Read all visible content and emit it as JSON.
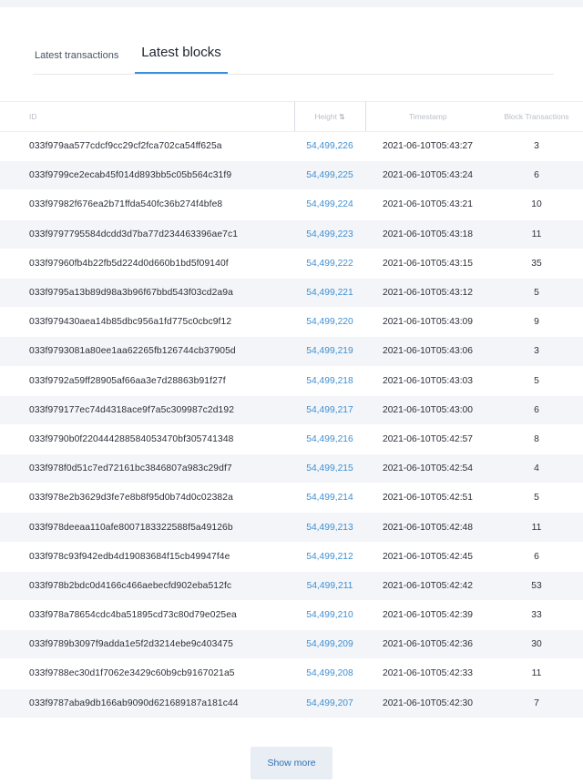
{
  "tabs": [
    {
      "label": "Latest transactions",
      "active": false
    },
    {
      "label": "Latest blocks",
      "active": true
    }
  ],
  "table": {
    "headers": {
      "id": "ID",
      "height": "Height",
      "timestamp": "Timestamp",
      "block_transactions": "Block Transactions"
    },
    "sort_icon": "sort-icon",
    "rows": [
      {
        "id": "033f979aa577cdcf9cc29cf2fca702ca54ff625a",
        "height": "54,499,226",
        "timestamp": "2021-06-10T05:43:27",
        "tx": "3"
      },
      {
        "id": "033f9799ce2ecab45f014d893bb5c05b564c31f9",
        "height": "54,499,225",
        "timestamp": "2021-06-10T05:43:24",
        "tx": "6"
      },
      {
        "id": "033f97982f676ea2b71ffda540fc36b274f4bfe8",
        "height": "54,499,224",
        "timestamp": "2021-06-10T05:43:21",
        "tx": "10"
      },
      {
        "id": "033f9797795584dcdd3d7ba77d234463396ae7c1",
        "height": "54,499,223",
        "timestamp": "2021-06-10T05:43:18",
        "tx": "11"
      },
      {
        "id": "033f97960fb4b22fb5d224d0d660b1bd5f09140f",
        "height": "54,499,222",
        "timestamp": "2021-06-10T05:43:15",
        "tx": "35"
      },
      {
        "id": "033f9795a13b89d98a3b96f67bbd543f03cd2a9a",
        "height": "54,499,221",
        "timestamp": "2021-06-10T05:43:12",
        "tx": "5"
      },
      {
        "id": "033f979430aea14b85dbc956a1fd775c0cbc9f12",
        "height": "54,499,220",
        "timestamp": "2021-06-10T05:43:09",
        "tx": "9"
      },
      {
        "id": "033f9793081a80ee1aa62265fb126744cb37905d",
        "height": "54,499,219",
        "timestamp": "2021-06-10T05:43:06",
        "tx": "3"
      },
      {
        "id": "033f9792a59ff28905af66aa3e7d28863b91f27f",
        "height": "54,499,218",
        "timestamp": "2021-06-10T05:43:03",
        "tx": "5"
      },
      {
        "id": "033f979177ec74d4318ace9f7a5c309987c2d192",
        "height": "54,499,217",
        "timestamp": "2021-06-10T05:43:00",
        "tx": "6"
      },
      {
        "id": "033f9790b0f220444288584053470bf305741348",
        "height": "54,499,216",
        "timestamp": "2021-06-10T05:42:57",
        "tx": "8"
      },
      {
        "id": "033f978f0d51c7ed72161bc3846807a983c29df7",
        "height": "54,499,215",
        "timestamp": "2021-06-10T05:42:54",
        "tx": "4"
      },
      {
        "id": "033f978e2b3629d3fe7e8b8f95d0b74d0c02382a",
        "height": "54,499,214",
        "timestamp": "2021-06-10T05:42:51",
        "tx": "5"
      },
      {
        "id": "033f978deeaa110afe8007183322588f5a49126b",
        "height": "54,499,213",
        "timestamp": "2021-06-10T05:42:48",
        "tx": "11"
      },
      {
        "id": "033f978c93f942edb4d19083684f15cb49947f4e",
        "height": "54,499,212",
        "timestamp": "2021-06-10T05:42:45",
        "tx": "6"
      },
      {
        "id": "033f978b2bdc0d4166c466aebecfd902eba512fc",
        "height": "54,499,211",
        "timestamp": "2021-06-10T05:42:42",
        "tx": "53"
      },
      {
        "id": "033f978a78654cdc4ba51895cd73c80d79e025ea",
        "height": "54,499,210",
        "timestamp": "2021-06-10T05:42:39",
        "tx": "33"
      },
      {
        "id": "033f9789b3097f9addа1e5f2d3214ebe9c403475",
        "height": "54,499,209",
        "timestamp": "2021-06-10T05:42:36",
        "tx": "30"
      },
      {
        "id": "033f9788ec30d1f7062e3429c60b9cb9167021a5",
        "height": "54,499,208",
        "timestamp": "2021-06-10T05:42:33",
        "tx": "11"
      },
      {
        "id": "033f9787aba9db166ab9090d621689187a181c44",
        "height": "54,499,207",
        "timestamp": "2021-06-10T05:42:30",
        "tx": "7"
      }
    ]
  },
  "show_more_label": "Show more",
  "colors": {
    "link": "#3f8fd2",
    "active_tab_underline": "#3b8fd9",
    "row_stripe": "#f3f5f8",
    "button_bg": "#e9eef5"
  }
}
